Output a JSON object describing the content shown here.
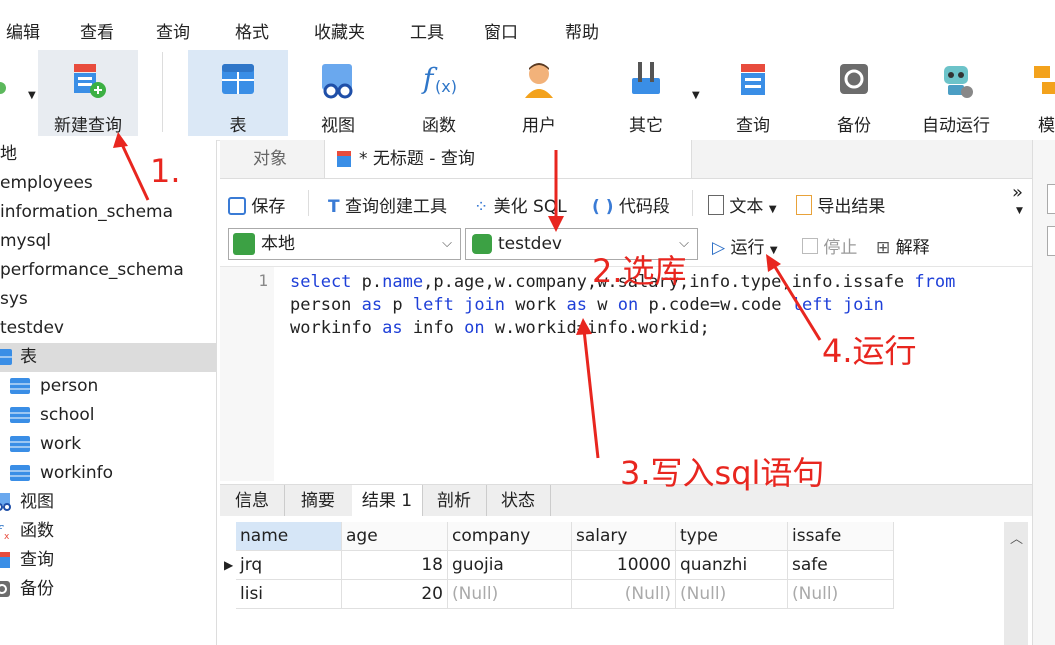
{
  "menu": [
    "编辑",
    "查看",
    "查询",
    "格式",
    "收藏夹",
    "工具",
    "窗口",
    "帮助"
  ],
  "toolbar": {
    "new_query": "新建查询",
    "table": "表",
    "view": "视图",
    "function": "函数",
    "user": "用户",
    "other": "其它",
    "query": "查询",
    "backup": "备份",
    "auto_run": "自动运行",
    "model": "模"
  },
  "tree": {
    "items": [
      "地",
      "employees",
      "information_schema",
      "mysql",
      "performance_schema",
      "sys",
      "testdev"
    ],
    "testdev_children": {
      "tables_label": "表",
      "tables": [
        "person",
        "school",
        "work",
        "workinfo"
      ],
      "views": "视图",
      "functions": "函数",
      "queries": "查询",
      "backups": "备份"
    }
  },
  "tabs": {
    "objects": "对象",
    "query_tab": "* 无标题 - 查询"
  },
  "editor_toolbar": {
    "save": "保存",
    "query_builder": "查询创建工具",
    "beautify": "美化 SQL",
    "snippet": "代码段",
    "text": "文本",
    "export": "导出结果",
    "more": "»"
  },
  "selectors": {
    "connection": "本地",
    "database": "testdev",
    "run": "运行",
    "stop": "停止",
    "explain": "解释"
  },
  "editor": {
    "line_number": "1"
  },
  "result_tabs": [
    "信息",
    "摘要",
    "结果 1",
    "剖析",
    "状态"
  ],
  "grid": {
    "columns": [
      "name",
      "age",
      "company",
      "salary",
      "type",
      "issafe"
    ],
    "rows": [
      [
        "jrq",
        "18",
        "guojia",
        "10000",
        "quanzhi",
        "safe"
      ],
      [
        "lisi",
        "20",
        "(Null)",
        "(Null)",
        "(Null)",
        "(Null)"
      ]
    ]
  },
  "annotations": {
    "step1": "1.",
    "step2": "2.选库",
    "step3": "3.写入sql语句",
    "step4": "4.运行"
  },
  "colors": {
    "keyword": "#1f40d8",
    "annotation": "#e8261f",
    "active_tool": "#dbe8f6"
  }
}
